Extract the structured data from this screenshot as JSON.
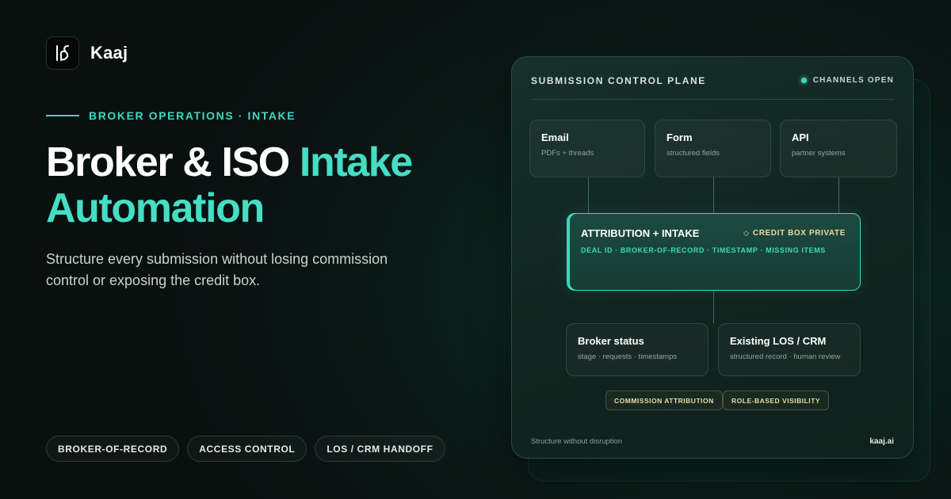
{
  "brand": {
    "name": "Kaaj",
    "logo_icon": "kaaj-monogram-icon"
  },
  "eyebrow": "BROKER OPERATIONS · INTAKE",
  "headline": {
    "part1": "Broker & ISO ",
    "accent1": "Intake",
    "accent2": "Automation"
  },
  "subhead": "Structure every submission without losing commission control or exposing the credit box.",
  "pills": [
    "BROKER-OF-RECORD",
    "ACCESS CONTROL",
    "LOS / CRM HANDOFF"
  ],
  "panel": {
    "title": "SUBMISSION CONTROL PLANE",
    "status": "CHANNELS OPEN",
    "channels": [
      {
        "title": "Email",
        "sub": "PDFs + threads"
      },
      {
        "title": "Form",
        "sub": "structured fields"
      },
      {
        "title": "API",
        "sub": "partner systems"
      }
    ],
    "attribution": {
      "title": "ATTRIBUTION + INTAKE",
      "badge": "CREDIT BOX PRIVATE",
      "badge_icon": "diamond-icon",
      "sub": "DEAL ID · BROKER-OF-RECORD · TIMESTAMP · MISSING ITEMS"
    },
    "outputs": [
      {
        "title": "Broker status",
        "sub": "stage · requests · timestamps"
      },
      {
        "title": "Existing LOS / CRM",
        "sub": "structured record · human review"
      }
    ],
    "tags": [
      "COMMISSION ATTRIBUTION",
      "ROLE-BASED VISIBILITY"
    ],
    "footer_left": "Structure without disruption",
    "footer_right": "kaaj.ai"
  },
  "colors": {
    "accent": "#3ed8bf",
    "gold": "#f0d9a0",
    "background": "#0a1412"
  }
}
